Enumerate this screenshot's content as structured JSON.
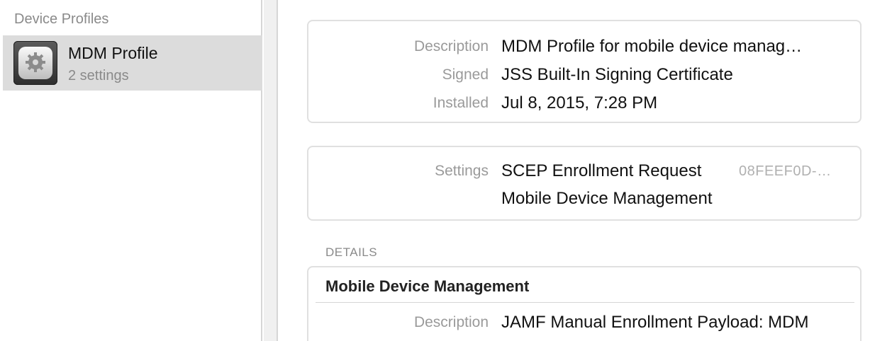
{
  "sidebar": {
    "header": "Device Profiles",
    "items": [
      {
        "title": "MDM Profile",
        "subtitle": "2 settings",
        "icon": "gear-cloud-icon"
      }
    ]
  },
  "overview": {
    "rows": [
      {
        "label": "Description",
        "value": "MDM Profile for mobile device manag…"
      },
      {
        "label": "Signed",
        "value": "JSS Built-In Signing Certificate"
      },
      {
        "label": "Installed",
        "value": "Jul 8, 2015, 7:28 PM"
      }
    ]
  },
  "settings": {
    "label": "Settings",
    "items": [
      {
        "name": "SCEP Enrollment Request",
        "id": "08FEEF0D-…"
      },
      {
        "name": "Mobile Device Management"
      }
    ]
  },
  "details": {
    "heading": "DETAILS",
    "sections": [
      {
        "title": "Mobile Device Management",
        "rows": [
          {
            "label": "Description",
            "value": "JAMF Manual Enrollment Payload: MDM"
          }
        ]
      }
    ]
  },
  "colors": {
    "selection": "#dcdcdc",
    "label": "#9a9a9a",
    "border": "#e0e0e0"
  }
}
